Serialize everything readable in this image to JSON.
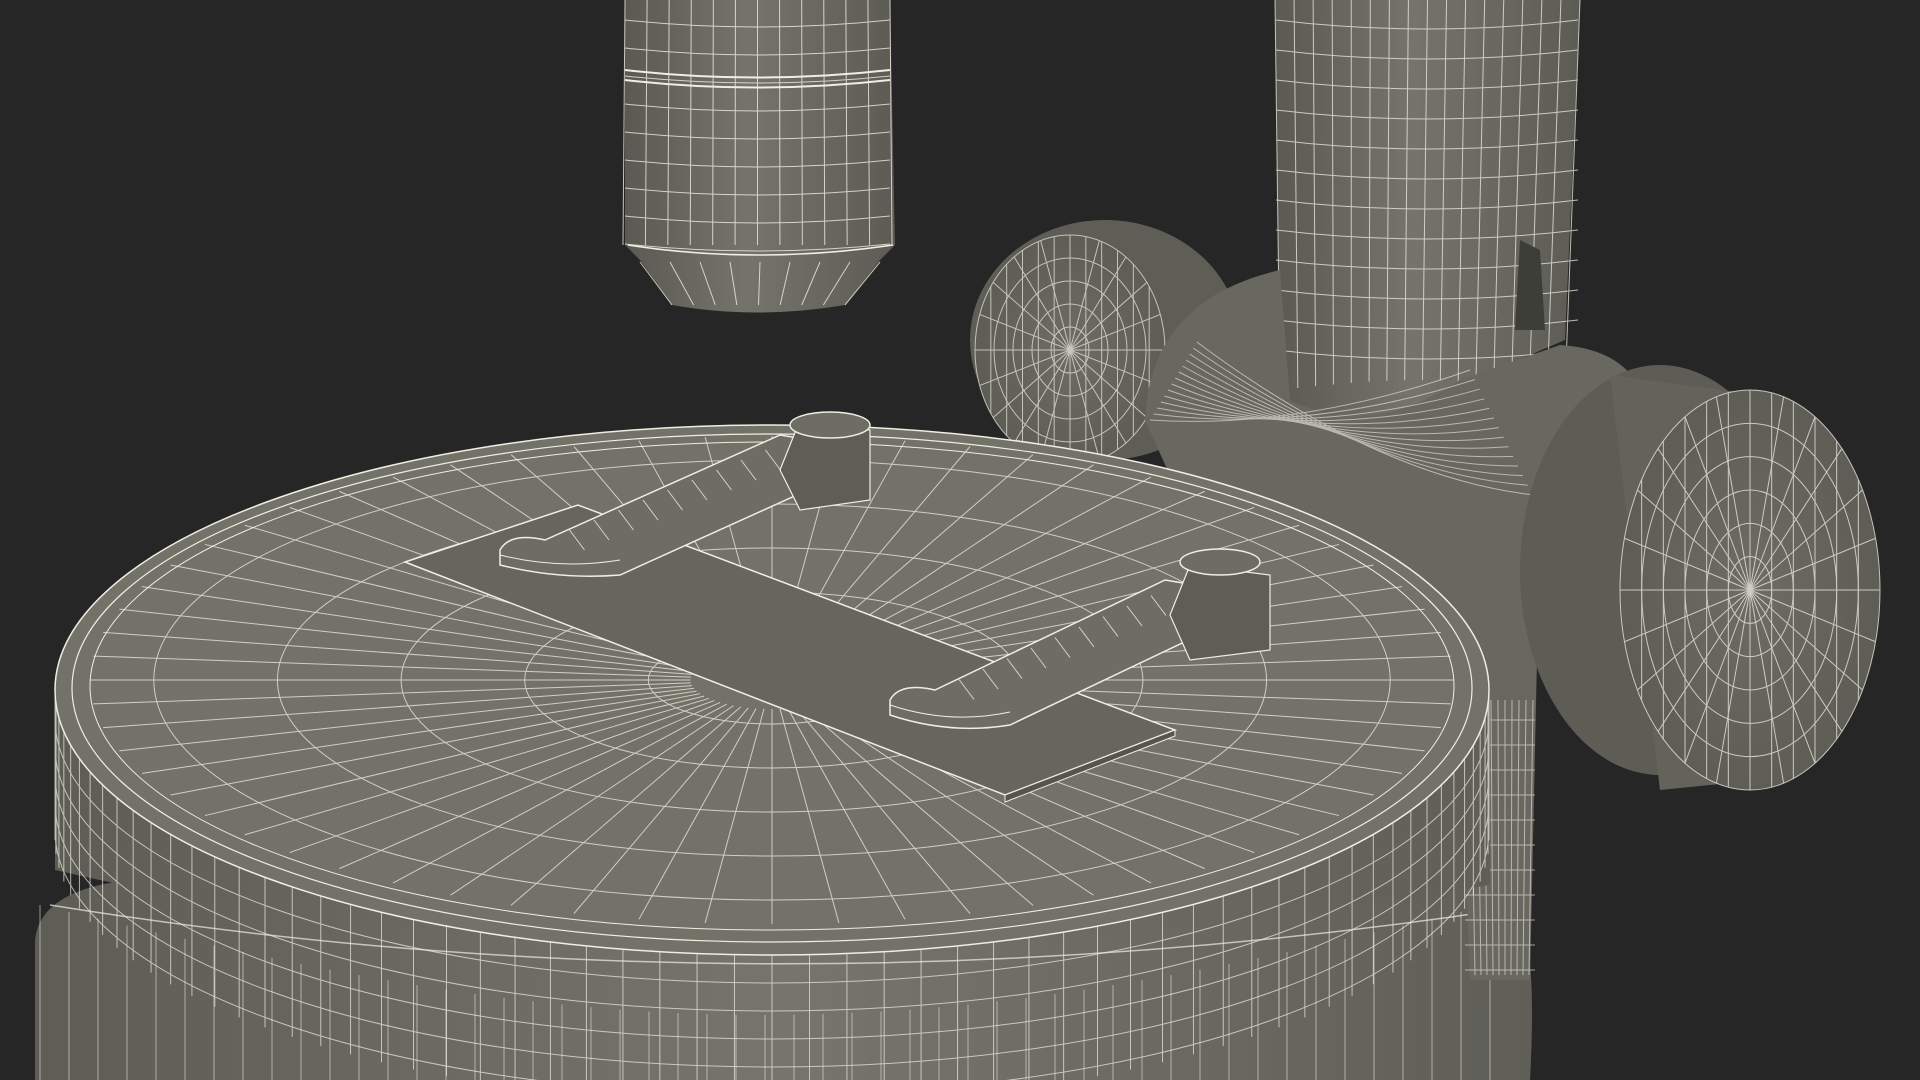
{
  "scene": {
    "subject": "microscope-stage-wireframe",
    "background_color": "#262626",
    "surface_color": "#6f6f66",
    "surface_shadow_color": "#55554e",
    "wire_color": "#eeeee2"
  }
}
